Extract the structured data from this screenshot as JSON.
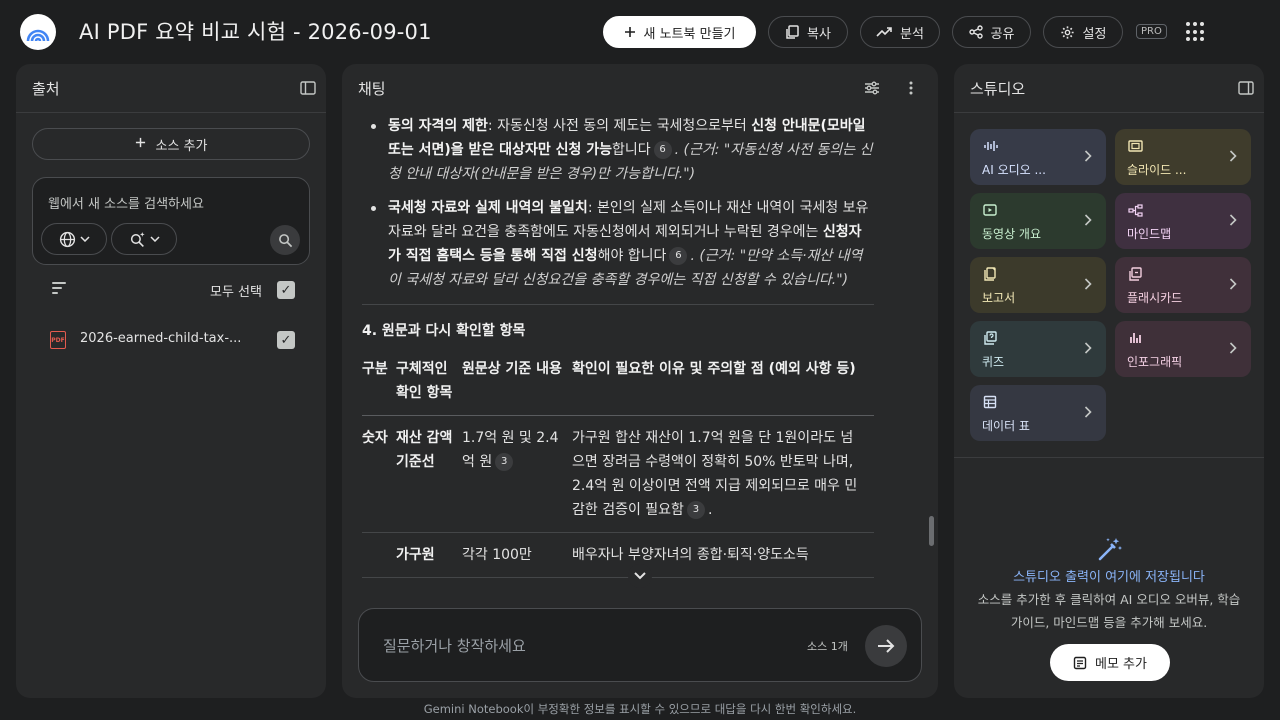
{
  "header": {
    "title": "AI PDF 요약 비교 시험 - 2026-09-01",
    "new_notebook_label": "새 노트북 만들기",
    "copy_label": "복사",
    "analyze_label": "분석",
    "share_label": "공유",
    "settings_label": "설정",
    "pro_badge": "PRO"
  },
  "sources_panel": {
    "title": "출처",
    "add_source_label": "소스 추가",
    "web_search_placeholder": "웹에서 새 소스를 검색하세요",
    "select_all_label": "모두 선택",
    "sources": [
      {
        "name": "2026-earned-child-tax-...",
        "type": "PDF",
        "checked": true
      }
    ]
  },
  "chat_panel": {
    "title": "채팅",
    "bullets": [
      {
        "lead": "동의 자격의 제한",
        "t1": ": 자동신청 사전 동의 제도는 국세청으로부터 ",
        "b1": "신청 안내문(모바일 또는 서면)을 받은 대상자만 신청 가능",
        "t2": "합니다",
        "cite": "6",
        "quote": ". (근거: \"자동신청 사전 동의는 신청 안내 대상자(안내문을 받은 경우)만 가능합니다.\")"
      },
      {
        "lead": "국세청 자료와 실제 내역의 불일치",
        "t1": ": 본인의 실제 소득이나 재산 내역이 국세청 보유 자료와 달라 요건을 충족함에도 자동신청에서 제외되거나 누락된 경우에는 ",
        "b1": "신청자가 직접 홈택스 등을 통해 직접 신청",
        "t2": "해야 합니다",
        "cite": "6",
        "quote": ". (근거: \"만약 소득·재산 내역이 국세청 자료와 달라 신청요건을 충족할 경우에는 직접 신청할 수 있습니다.\")"
      }
    ],
    "section_title": "4. 원문과 다시 확인할 항목",
    "table": {
      "headers": [
        "구분",
        "구체적인 확인 항목",
        "원문상 기준 내용",
        "확인이 필요한 이유 및 주의할 점 (예외 사항 등)"
      ],
      "rows": [
        {
          "c1": "숫자",
          "c2": "재산 감액 기준선",
          "c3": "1.7억 원 및 2.4억 원",
          "c3_cite": "3",
          "c4": "가구원 합산 재산이 1.7억 원을 단 1원이라도 넘으면 장려금 수령액이 정확히 50% 반토막 나며, 2.4억 원 이상이면 전액 지급 제외되므로 매우 민감한 검증이 필요함",
          "c4_cite": "3"
        },
        {
          "c1": "",
          "c2": "가구원",
          "c3": "각각 100만",
          "c3_cite": "",
          "c4": "배우자나 부양자녀의 종합·퇴직·양도소득",
          "c4_cite": ""
        }
      ]
    },
    "composer_placeholder": "질문하거나 창작하세요",
    "source_count": "소스 1개"
  },
  "studio_panel": {
    "title": "스튜디오",
    "tiles": [
      {
        "label": "AI 오디오 ...",
        "icon": "audio-waveform-icon",
        "bg": "#373b48",
        "fg": "#d7e3ff"
      },
      {
        "label": "슬라이드 ...",
        "icon": "slides-icon",
        "bg": "#3f3c2c",
        "fg": "#f2e6b3"
      },
      {
        "label": "동영상 개요",
        "icon": "video-icon",
        "bg": "#2c3a2e",
        "fg": "#c8efcf"
      },
      {
        "label": "마인드맵",
        "icon": "mindmap-icon",
        "bg": "#3f3040",
        "fg": "#f4d4f6"
      },
      {
        "label": "보고서",
        "icon": "report-icon",
        "bg": "#3c3a2b",
        "fg": "#f2e8b6"
      },
      {
        "label": "플래시카드",
        "icon": "flashcard-icon",
        "bg": "#40303a",
        "fg": "#f4cfe0"
      },
      {
        "label": "퀴즈",
        "icon": "quiz-icon",
        "bg": "#2f3a3c",
        "fg": "#cfeaf0"
      },
      {
        "label": "인포그래픽",
        "icon": "infographic-icon",
        "bg": "#3f3039",
        "fg": "#f4d0e4"
      },
      {
        "label": "데이터 표",
        "icon": "data-table-icon",
        "bg": "#353842",
        "fg": "#d7e1f5"
      }
    ],
    "empty_title": "스튜디오 출력이 여기에 저장됩니다",
    "empty_desc": "소스를 추가한 후 클릭하여 AI 오디오 오버뷰, 학습 가이드, 마인드맵 등을 추가해 보세요.",
    "memo_label": "메모 추가"
  },
  "footer_text": "Gemini Notebook이 부정확한 정보를 표시할 수 있으므로 대답을 다시 한번 확인하세요.",
  "colors": {
    "background": "#1e1f20",
    "panel": "#28292a",
    "accent_blue": "#8ab4f8",
    "pdf_red": "#e35b4f"
  }
}
